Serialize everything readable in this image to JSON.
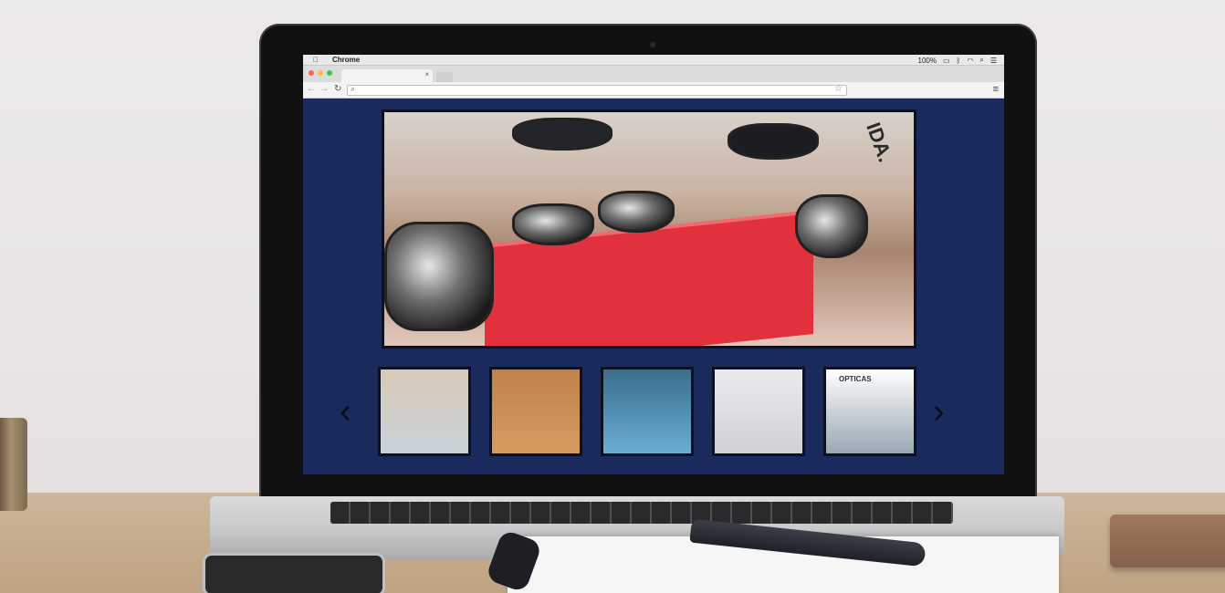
{
  "browser": {
    "app_name": "Chrome",
    "battery": "100%",
    "tab_close": "×"
  },
  "icons": {
    "apple": "apple-icon",
    "back": "back-arrow-icon",
    "forward": "forward-arrow-icon",
    "reload": "reload-icon",
    "search": "search-icon",
    "bookmark": "star-icon",
    "menu": "hamburger-menu-icon",
    "wifi": "wifi-icon",
    "bluetooth": "bluetooth-icon",
    "spotlight": "magnifier-icon",
    "notifications": "list-icon",
    "slider_prev": "chevron-left-icon",
    "slider_next": "chevron-right-icon"
  },
  "gallery": {
    "hero_sign_text": "IDA.",
    "thumbnails": [
      {
        "caption": ""
      },
      {
        "caption": ""
      },
      {
        "caption": ""
      },
      {
        "caption": ""
      },
      {
        "caption": "OPTICAS"
      }
    ],
    "prev_glyph": "‹",
    "next_glyph": "›"
  },
  "colors": {
    "site_background": "#1b2a5c",
    "frame": "#0c1122"
  }
}
